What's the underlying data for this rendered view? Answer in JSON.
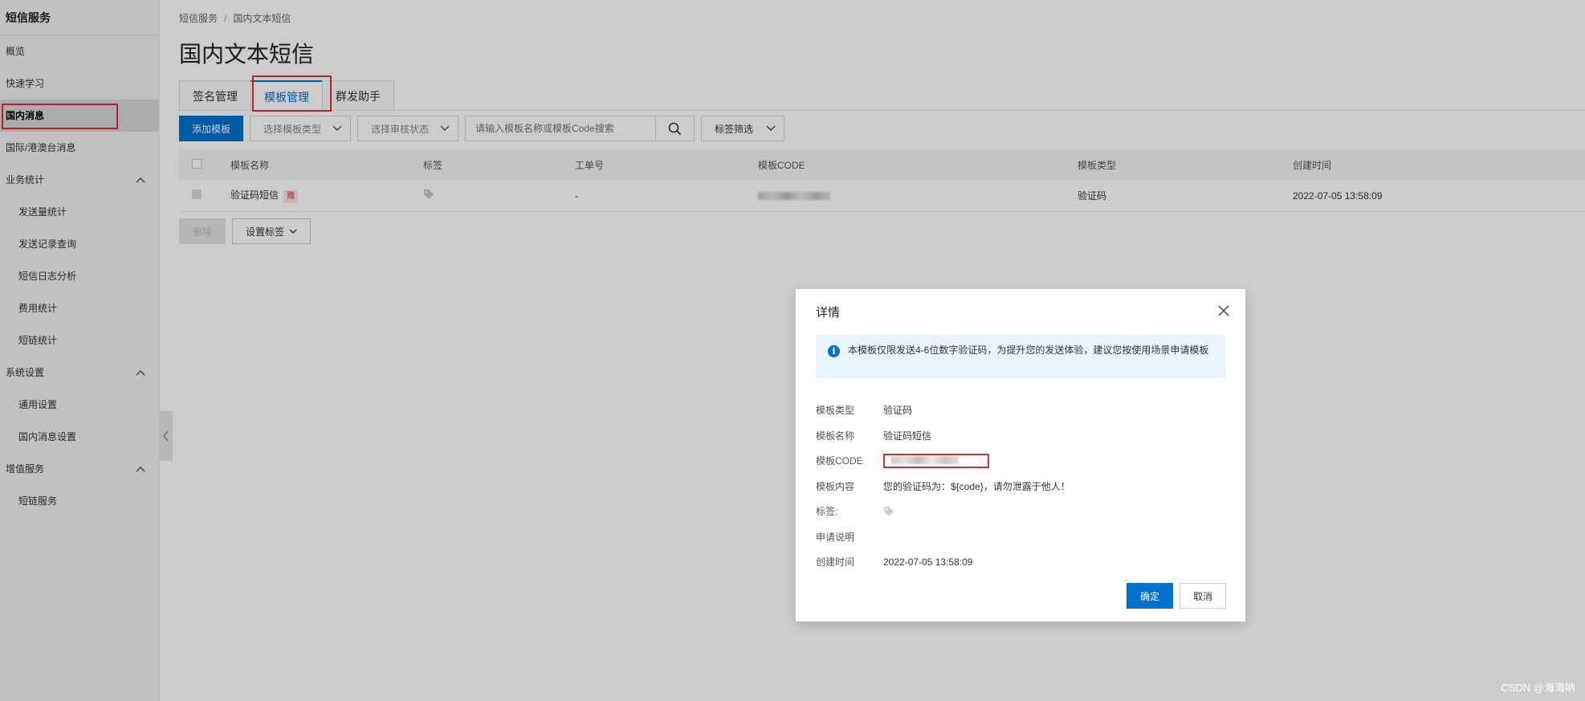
{
  "sidebar": {
    "title": "短信服务",
    "items": [
      {
        "label": "概览"
      },
      {
        "label": "快速学习"
      },
      {
        "label": "国内消息"
      },
      {
        "label": "国际/港澳台消息"
      },
      {
        "label": "业务统计"
      },
      {
        "label": "发送量统计"
      },
      {
        "label": "发送记录查询"
      },
      {
        "label": "短信日志分析"
      },
      {
        "label": "费用统计"
      },
      {
        "label": "短链统计"
      },
      {
        "label": "系统设置"
      },
      {
        "label": "通用设置"
      },
      {
        "label": "国内消息设置"
      },
      {
        "label": "增值服务"
      },
      {
        "label": "短链服务"
      }
    ]
  },
  "breadcrumb": {
    "root": "短信服务",
    "sep": "/",
    "current": "国内文本短信"
  },
  "page_title": "国内文本短信",
  "tabs": [
    {
      "label": "签名管理"
    },
    {
      "label": "模板管理"
    },
    {
      "label": "群发助手"
    }
  ],
  "toolbar": {
    "add_label": "添加模板",
    "type_select": "选择模板类型",
    "status_select": "选择审核状态",
    "search_placeholder": "请输入模板名称或模板Code搜索",
    "tag_filter": "标签筛选"
  },
  "table": {
    "headers": [
      "模板名称",
      "标签",
      "工单号",
      "模板CODE",
      "模板类型",
      "创建时间"
    ],
    "rows": [
      {
        "name": "验证码短信",
        "badge": "赠",
        "order": "-",
        "code": "SMS_2••••••",
        "type": "验证码",
        "created": "2022-07-05 13:58:09"
      }
    ]
  },
  "bottom": {
    "delete_label": "删除",
    "set_tag_label": "设置标签"
  },
  "dialog": {
    "title": "详情",
    "notice": "本模板仅限发送4-6位数字验证码，为提升您的发送体验，建议您按使用场景申请模板",
    "fields": [
      {
        "k": "模板类型",
        "v": "验证码"
      },
      {
        "k": "模板名称",
        "v": "验证码短信"
      },
      {
        "k": "模板CODE",
        "v": "SMS_2••••••"
      },
      {
        "k": "模板内容",
        "v": "您的验证码为：${code}，请勿泄露于他人！"
      },
      {
        "k": "标签:",
        "v": ""
      },
      {
        "k": "申请说明",
        "v": ""
      },
      {
        "k": "创建时间",
        "v": "2022-07-05 13:58:09"
      }
    ],
    "ok_label": "确定",
    "cancel_label": "取消"
  },
  "watermark": "CSDN @海海呐",
  "colors": {
    "primary": "#0070cc",
    "highlight": "#e02d2d"
  }
}
